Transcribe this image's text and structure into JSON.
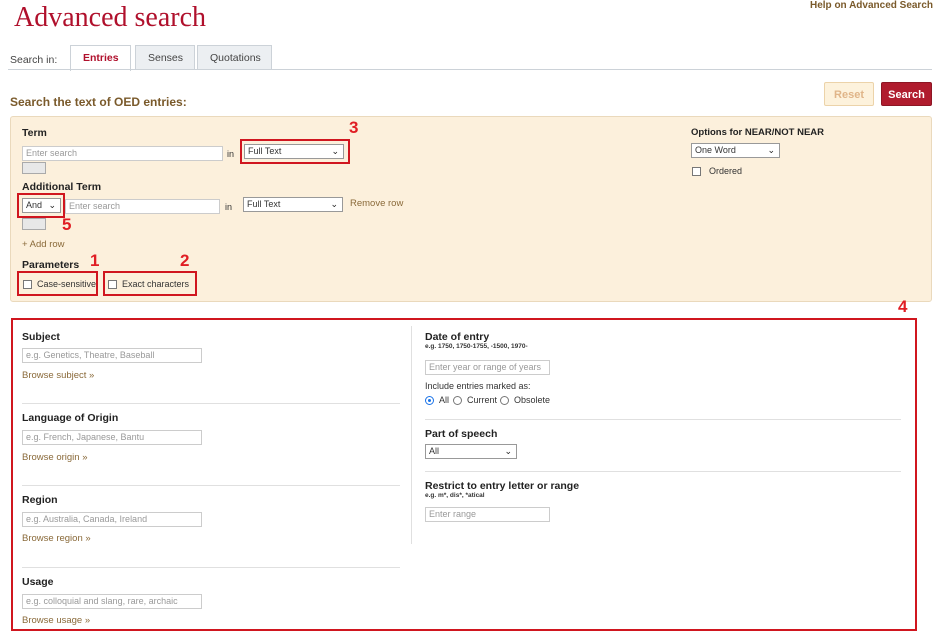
{
  "header": {
    "title": "Advanced search",
    "help_link": "Help on Advanced Search"
  },
  "tabs": {
    "search_in_label": "Search in:",
    "items": [
      {
        "label": "Entries"
      },
      {
        "label": "Senses"
      },
      {
        "label": "Quotations"
      }
    ],
    "active": "Entries"
  },
  "subheading": "Search the text of OED entries:",
  "toolbar": {
    "reset_label": "Reset",
    "search_label": "Search"
  },
  "term": {
    "label": "Term",
    "input_placeholder": "Enter search",
    "in_label": "in",
    "field_select": "Full Text"
  },
  "additional_term": {
    "label": "Additional Term",
    "operator_select": "And",
    "input_placeholder": "Enter search",
    "in_label": "in",
    "field_select": "Full Text",
    "remove_row": "Remove row"
  },
  "add_row": "+ Add row",
  "parameters": {
    "label": "Parameters",
    "case_sensitive": "Case-sensitive",
    "exact_characters": "Exact characters"
  },
  "near_options": {
    "label": "Options for NEAR/NOT NEAR",
    "select": "One Word",
    "ordered_label": "Ordered"
  },
  "filters": {
    "subject": {
      "label": "Subject",
      "placeholder": "e.g. Genetics, Theatre, Baseball",
      "browse": "Browse subject »"
    },
    "origin": {
      "label": "Language of Origin",
      "placeholder": "e.g. French, Japanese, Bantu",
      "browse": "Browse origin »"
    },
    "region": {
      "label": "Region",
      "placeholder": "e.g. Australia, Canada, Ireland",
      "browse": "Browse region »"
    },
    "usage": {
      "label": "Usage",
      "placeholder": "e.g. colloquial and slang, rare, archaic",
      "browse": "Browse usage »"
    },
    "date": {
      "label": "Date of entry",
      "hint": "e.g. 1750, 1750-1755, -1500, 1970-",
      "placeholder": "Enter year or range of years",
      "marked_label": "Include entries marked as:",
      "options": [
        "All",
        "Current",
        "Obsolete"
      ],
      "selected": "All"
    },
    "pos": {
      "label": "Part of speech",
      "select": "All"
    },
    "restrict": {
      "label": "Restrict to entry letter or range",
      "hint": "e.g. m*, dis*, *atical",
      "placeholder": "Enter range"
    }
  },
  "annotations": {
    "n1": "1",
    "n2": "2",
    "n3": "3",
    "n4": "4",
    "n5": "5"
  },
  "colors": {
    "brand_red": "#b0102c",
    "annotation_red": "#d0161f",
    "panel_bg": "#fcf0dc"
  }
}
